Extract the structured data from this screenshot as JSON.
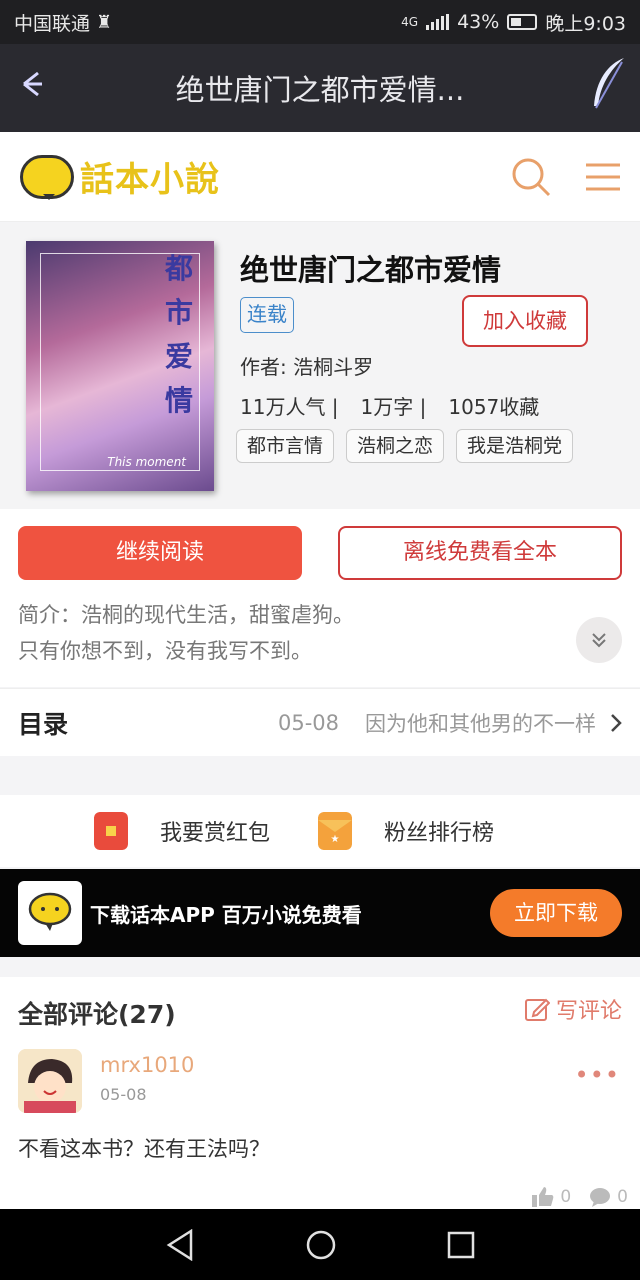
{
  "status_bar": {
    "carrier": "中国联通",
    "network": "4G",
    "battery": "43%",
    "time": "晚上9:03"
  },
  "title_bar": {
    "title": "绝世唐门之都市爱情..."
  },
  "app_header": {
    "logo_text": "話本小說"
  },
  "book": {
    "cover_title": "都市爱情",
    "cover_caption": "This moment",
    "title": "绝世唐门之都市爱情",
    "status_tag": "连载",
    "collect_button": "加入收藏",
    "author": "作者: 浩桐斗罗",
    "popularity": "11万人气 |",
    "word_count": "1万字 |",
    "favorites": "1057收藏",
    "tags": [
      "都市言情",
      "浩桐之恋",
      "我是浩桐党"
    ]
  },
  "actions": {
    "read_button": "继续阅读",
    "offline_button": "离线免费看全本",
    "intro_line1": "简介：浩桐的现代生活，甜蜜虐狗。",
    "intro_line2": "只有你想不到，没有我写不到。"
  },
  "toc": {
    "label": "目录",
    "latest_date": "05-08",
    "latest_chapter": "因为他和其他男的不一样"
  },
  "reward": {
    "red_packet": "我要赏红包",
    "fan_ranking": "粉丝排行榜"
  },
  "banner": {
    "message": "下载话本APP 百万小说免费看",
    "download_button": "立即下载"
  },
  "comments": {
    "header": "全部评论(27)",
    "write": "写评论",
    "items": [
      {
        "user": "mrx1010",
        "date": "05-08",
        "text": "不看这本书？还有王法吗？",
        "likes": "0",
        "replies": "0"
      }
    ]
  },
  "colors": {
    "accent_red": "#ef5340",
    "accent_orange": "#f47b2a",
    "logo_yellow": "#f5d31f"
  }
}
